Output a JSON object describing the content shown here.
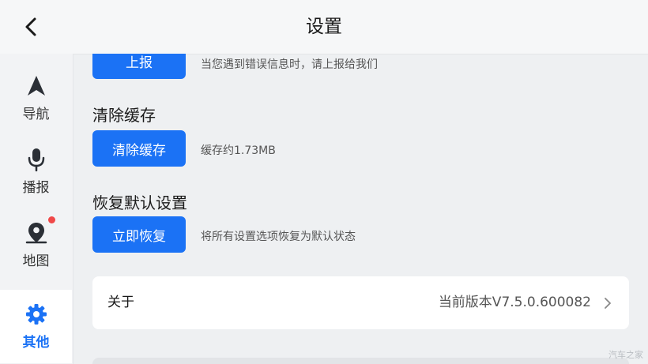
{
  "header": {
    "title": "设置"
  },
  "sidebar": {
    "items": [
      {
        "label": "导航",
        "icon": "navigation-arrow-icon",
        "active": false
      },
      {
        "label": "播报",
        "icon": "microphone-icon",
        "active": false
      },
      {
        "label": "地图",
        "icon": "map-pin-icon",
        "active": false,
        "badge": "red-dot"
      },
      {
        "label": "其他",
        "icon": "gear-icon",
        "active": true
      }
    ]
  },
  "main": {
    "report": {
      "button_label": "上报",
      "description": "当您遇到错误信息时，请上报给我们"
    },
    "clear_cache": {
      "title": "清除缓存",
      "button_label": "清除缓存",
      "description": "缓存约1.73MB"
    },
    "restore_defaults": {
      "title": "恢复默认设置",
      "button_label": "立即恢复",
      "description": "将所有设置选项恢复为默认状态"
    },
    "about": {
      "label": "关于",
      "version": "当前版本V7.5.0.600082"
    }
  },
  "watermark": "汽车之家",
  "colors": {
    "accent": "#1b72f5",
    "badge": "#f04848",
    "background": "#eef0f2"
  }
}
